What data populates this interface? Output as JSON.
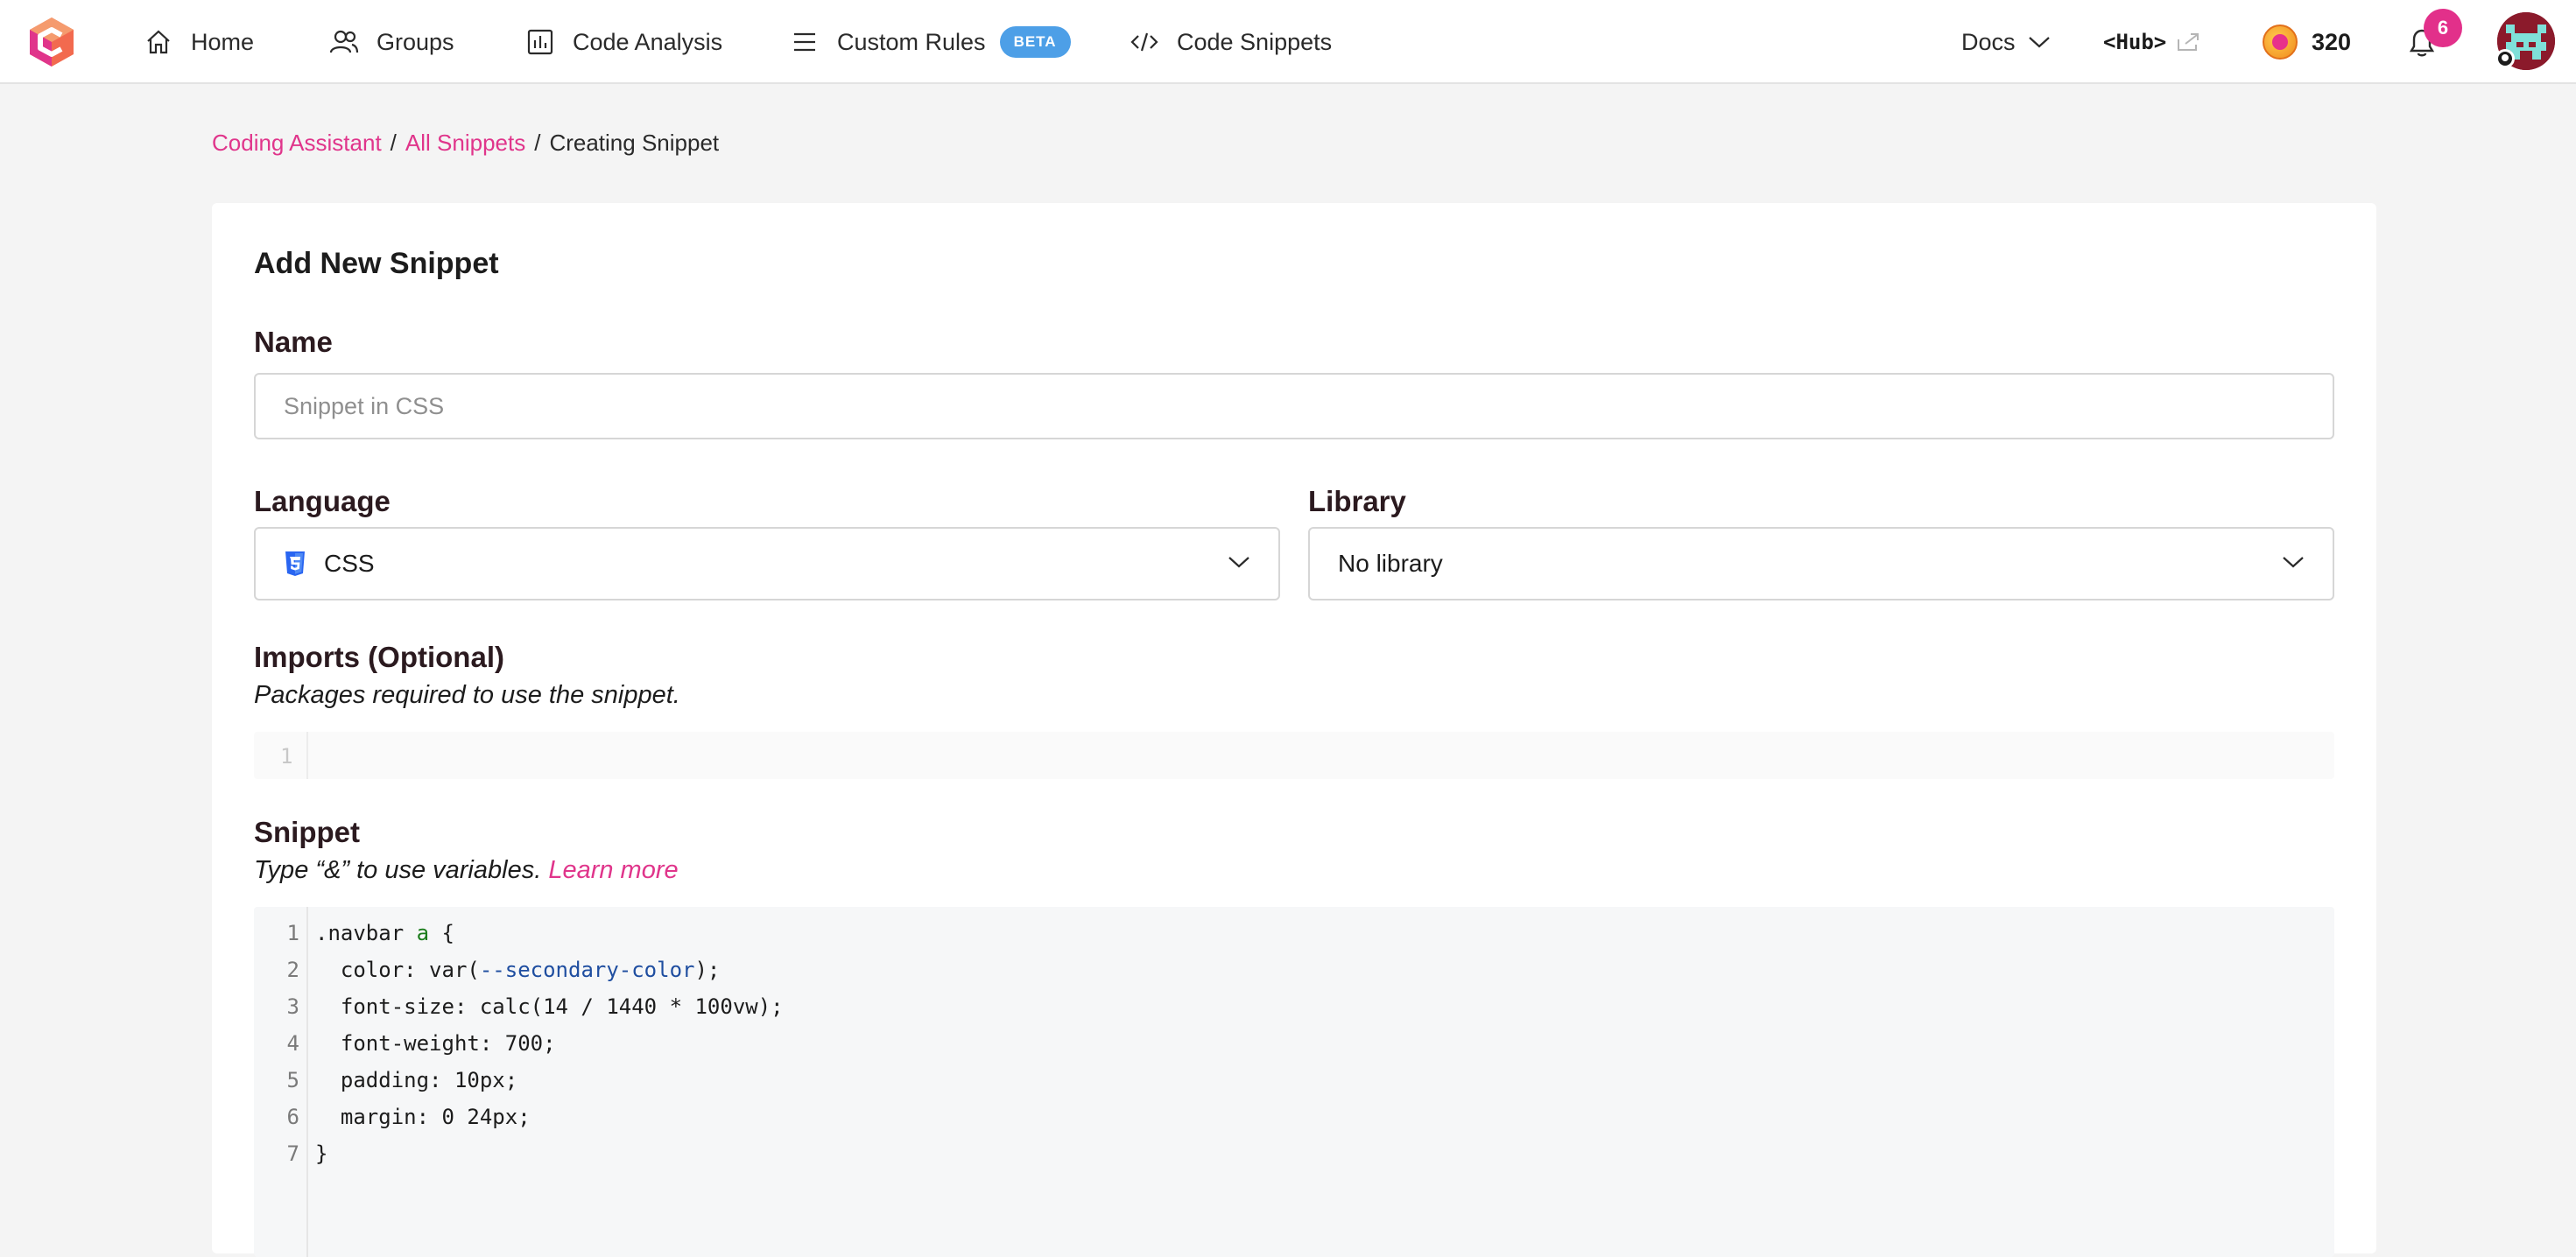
{
  "nav": {
    "items": [
      {
        "label": "Home",
        "icon": "home-icon"
      },
      {
        "label": "Groups",
        "icon": "users-icon"
      },
      {
        "label": "Code Analysis",
        "icon": "chart-icon"
      },
      {
        "label": "Custom Rules",
        "icon": "list-icon",
        "badge": "BETA"
      },
      {
        "label": "Code Snippets",
        "icon": "code-icon"
      }
    ],
    "docs_label": "Docs",
    "hub_label": "<Hub>",
    "points": "320",
    "notifications": "6",
    "colors": {
      "accent": "#e0358b",
      "beta": "#4d9fe7"
    }
  },
  "breadcrumb": {
    "items": [
      "Coding Assistant",
      "All Snippets",
      "Creating Snippet"
    ],
    "separator": "/"
  },
  "form": {
    "title": "Add New Snippet",
    "name_label": "Name",
    "name_placeholder": "Snippet in CSS",
    "language_label": "Language",
    "language_value": "CSS",
    "library_label": "Library",
    "library_value": "No library",
    "imports_label": "Imports (Optional)",
    "imports_hint": "Packages required to use the snippet.",
    "imports_line": "1",
    "snippet_label": "Snippet",
    "snippet_hint": "Type “&” to use variables.",
    "learn_more": "Learn more"
  },
  "code": {
    "lines": [
      {
        "n": "1",
        "parts": [
          [
            ".navbar ",
            ""
          ],
          [
            "a",
            "tag"
          ],
          [
            " {",
            ""
          ]
        ]
      },
      {
        "n": "2",
        "parts": [
          [
            "  color: var(",
            ""
          ],
          [
            "--secondary-color",
            "var"
          ],
          [
            ");",
            ""
          ]
        ]
      },
      {
        "n": "3",
        "parts": [
          [
            "  font-size: calc(14 / 1440 * 100vw);",
            ""
          ]
        ]
      },
      {
        "n": "4",
        "parts": [
          [
            "  font-weight: 700;",
            ""
          ]
        ]
      },
      {
        "n": "5",
        "parts": [
          [
            "  padding: 10px;",
            ""
          ]
        ]
      },
      {
        "n": "6",
        "parts": [
          [
            "  margin: 0 24px;",
            ""
          ]
        ]
      },
      {
        "n": "7",
        "parts": [
          [
            "}",
            ""
          ]
        ]
      }
    ]
  }
}
